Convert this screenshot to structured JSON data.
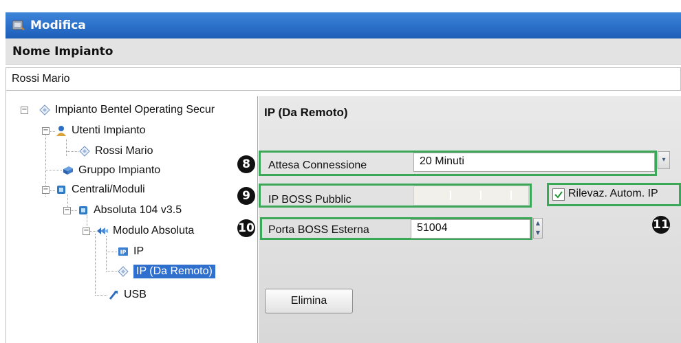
{
  "window": {
    "title": "Modifica"
  },
  "section_header": "Nome Impianto",
  "plant_name_value": "Rossi Mario",
  "tree": [
    {
      "label": "Impianto Bentel Operating Secur",
      "expander": "−"
    },
    {
      "label": "Utenti Impianto",
      "expander": "−"
    },
    {
      "label": "Rossi Mario"
    },
    {
      "label": "Gruppo Impianto"
    },
    {
      "label": "Centrali/Moduli",
      "expander": "−"
    },
    {
      "label": "Absoluta 104 v3.5",
      "expander": "−"
    },
    {
      "label": "Modulo Absoluta",
      "expander": "−"
    },
    {
      "label": "IP"
    },
    {
      "label": "IP (Da Remoto)",
      "selected": true
    },
    {
      "label": "USB"
    }
  ],
  "panel": {
    "title": "IP (Da Remoto)",
    "attesa": {
      "callout": "8",
      "label": "Attesa Connessione",
      "value": "20 Minuti",
      "dropdown_glyph": "▾"
    },
    "ip_boss": {
      "callout": "9",
      "label": "IP BOSS Pubblic",
      "value": ""
    },
    "rilevaz": {
      "callout": "11",
      "label": "Rilevaz. Autom. IP",
      "checked": true
    },
    "porta": {
      "callout": "10",
      "label": "Porta BOSS Esterna",
      "value": "51004"
    },
    "delete_button": "Elimina"
  },
  "colors": {
    "titlebar": "#2a6fc8",
    "highlight_box": "#3aa856",
    "selection": "#2f6fce"
  }
}
